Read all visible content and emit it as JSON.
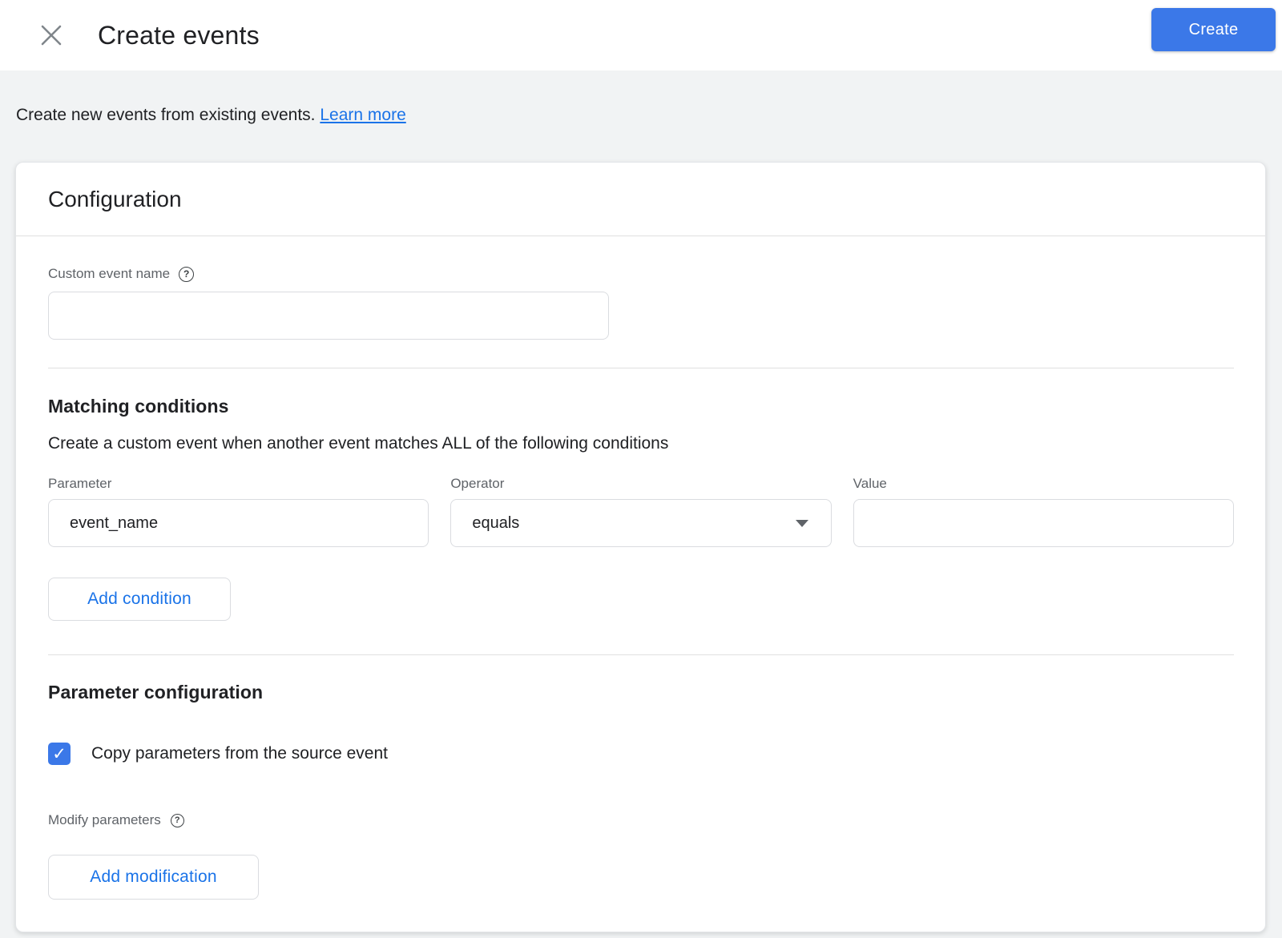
{
  "header": {
    "title": "Create events",
    "create_button_label": "Create"
  },
  "intro": {
    "text": "Create new events from existing events.",
    "learn_more_label": "Learn more"
  },
  "configuration": {
    "title": "Configuration",
    "custom_event_name": {
      "label": "Custom event name",
      "help_icon": "?",
      "value": "",
      "placeholder": ""
    }
  },
  "matching_conditions": {
    "title": "Matching conditions",
    "description": "Create a custom event when another event matches ALL of the following conditions",
    "parameter_label": "Parameter",
    "operator_label": "Operator",
    "value_label": "Value",
    "conditions": [
      {
        "parameter": "event_name",
        "operator": "equals",
        "value": ""
      }
    ],
    "add_condition_label": "Add condition"
  },
  "parameter_configuration": {
    "title": "Parameter configuration",
    "copy_parameters": {
      "checked": true,
      "check_icon": "✓",
      "label": "Copy parameters from the source event"
    },
    "modify_parameters_label": "Modify parameters",
    "help_icon": "?",
    "add_modification_label": "Add modification"
  },
  "colors": {
    "accent_blue": "#1a73e8",
    "button_blue": "#3b78e8",
    "background_gray": "#f1f3f4",
    "border_gray": "#dadce0",
    "text_dark": "#202124",
    "text_gray": "#5f6368"
  }
}
